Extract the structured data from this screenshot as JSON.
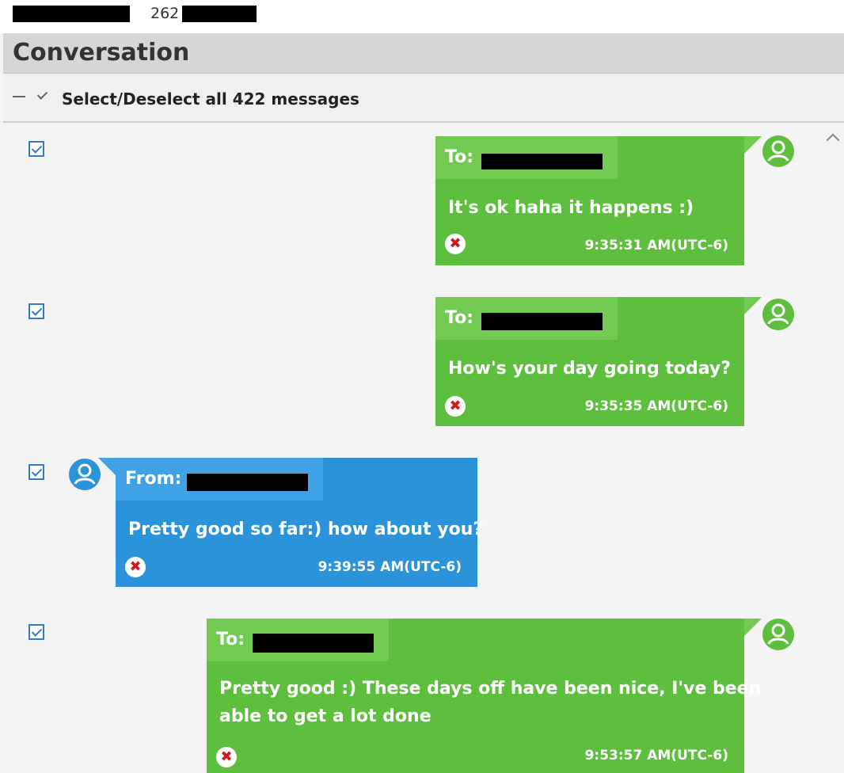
{
  "top_bar": {
    "number": "262"
  },
  "header": {
    "title": "Conversation"
  },
  "select_bar": {
    "label": "Select/Deselect all 422 messages"
  },
  "messages": [
    {
      "direction": "to",
      "label": "To:",
      "text": "It's ok haha it happens :)",
      "time": "9:35:31 AM(UTC-6)",
      "checked": true
    },
    {
      "direction": "to",
      "label": "To:",
      "text": "How's your day going today?",
      "time": "9:35:35 AM(UTC-6)",
      "checked": true
    },
    {
      "direction": "from",
      "label": "From:",
      "text": "Pretty good so far:) how about you?",
      "time": "9:39:55 AM(UTC-6)",
      "checked": true
    },
    {
      "direction": "to",
      "label": "To:",
      "text_line1": "Pretty good :) These days off have been nice, I've been",
      "text_line2": "able to get a lot done",
      "time": "9:53:57 AM(UTC-6)",
      "checked": true
    }
  ],
  "icons": {
    "delete": "x-circle-icon",
    "avatar": "user-avatar-icon",
    "scroll": "chevron-up-icon"
  },
  "colors": {
    "outgoing": "#5dbf3d",
    "incoming": "#2a93d9",
    "delete": "#d0191f"
  }
}
